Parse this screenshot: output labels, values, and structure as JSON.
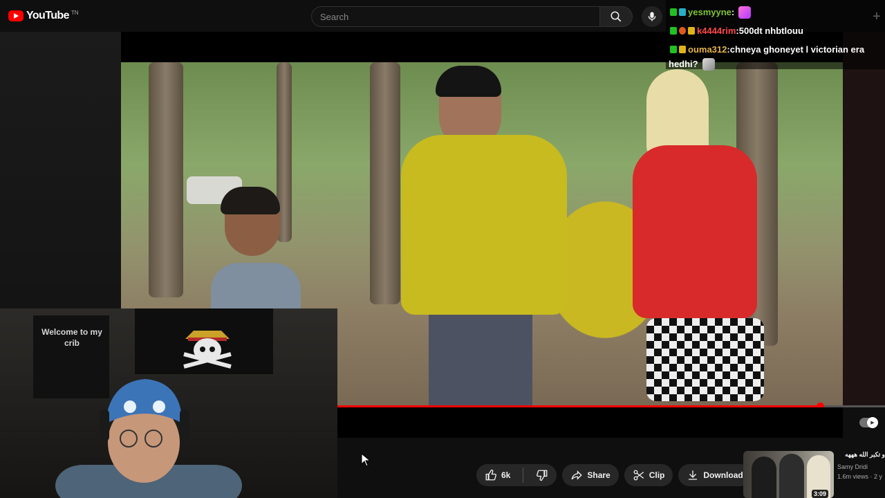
{
  "header": {
    "logo_text": "YouTube",
    "logo_tm": "TN",
    "search_placeholder": "Search"
  },
  "chat": {
    "messages": [
      {
        "user": "yesmyyne",
        "sep": " :",
        "text": "",
        "user_color": "green",
        "badges": [
          "k-badge",
          "sub-badge"
        ],
        "emote": "pink-feather-emote"
      },
      {
        "user": "k4444rim",
        "sep": " :",
        "text": " 500dt nhbtlouu",
        "user_color": "red",
        "badges": [
          "k-badge",
          "hat-badge",
          "crown-badge"
        ]
      },
      {
        "user": "ouma312",
        "sep": " :",
        "text": " chneya ghoneyet l victorian era",
        "user_color": "gold",
        "badges": [
          "k-badge",
          "crown-badge"
        ]
      }
    ],
    "wrap_line": "hedhi?"
  },
  "webcam": {
    "banner_text_line1": "Welcome to  my",
    "banner_text_line2": "crib"
  },
  "player": {
    "progress": 0.955
  },
  "actions": {
    "likes": "6k",
    "share": "Share",
    "clip": "Clip",
    "download": "Download"
  },
  "recommended": {
    "title": "و تكبر الله هههه",
    "channel": "Samy Dridi",
    "meta": "1.6m views · 2 y",
    "duration": "3:09"
  },
  "colors": {
    "accent": "#ff0000",
    "background": "#0f0f0f",
    "pill": "#272727"
  }
}
